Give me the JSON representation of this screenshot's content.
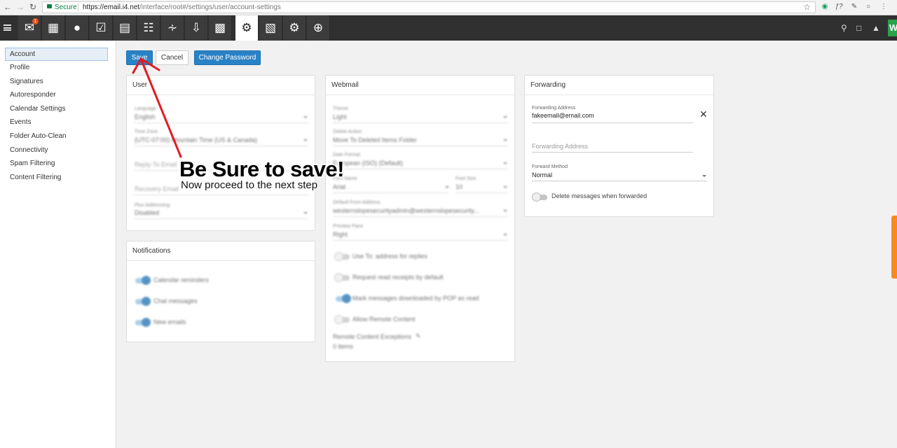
{
  "browser": {
    "secure_label": "Secure",
    "url_host": "https://email.i4.net",
    "url_path": "/interface/root#/settings/user/account-settings"
  },
  "appbar": {
    "mail_badge": "1",
    "avatar_letter": "W"
  },
  "sidebar": {
    "items": [
      {
        "label": "Account"
      },
      {
        "label": "Profile"
      },
      {
        "label": "Signatures"
      },
      {
        "label": "Autoresponder"
      },
      {
        "label": "Calendar Settings"
      },
      {
        "label": "Events"
      },
      {
        "label": "Folder Auto-Clean"
      },
      {
        "label": "Connectivity"
      },
      {
        "label": "Spam Filtering"
      },
      {
        "label": "Content Filtering"
      }
    ]
  },
  "actions": {
    "save": "Save",
    "cancel": "Cancel",
    "change_password": "Change Password"
  },
  "user_card": {
    "title": "User",
    "language_label": "Language",
    "language_value": "English",
    "timezone_label": "Time Zone",
    "timezone_value": "(UTC-07:00) Mountain Time (US & Canada)",
    "reply_to_label": "Reply-To Email",
    "recovery_label": "Recovery Email",
    "plus_addressing_label": "Plus Addressing",
    "plus_addressing_value": "Disabled"
  },
  "notifications_card": {
    "title": "Notifications",
    "items": [
      {
        "label": "Calendar reminders"
      },
      {
        "label": "Chat messages"
      },
      {
        "label": "New emails"
      }
    ]
  },
  "webmail_card": {
    "title": "Webmail",
    "theme_label": "Theme",
    "theme_value": "Light",
    "delete_action_label": "Delete Action",
    "delete_action_value": "Move To Deleted Items Folder",
    "date_format_label": "Date Format",
    "date_format_value": "European (ISO) (Default)",
    "font_label": "Font Name",
    "font_value": "Arial",
    "font_size_label": "Font Size",
    "font_size_value": "10",
    "from_label": "Default From Address",
    "from_value": "westernslopesecurityadmin@westernslopesecurity...",
    "preview_label": "Preview Pane",
    "preview_value": "Right",
    "toggles": [
      {
        "label": "Use To: address for replies"
      },
      {
        "label": "Request read receipts by default"
      },
      {
        "label": "Mark messages downloaded by POP as read"
      },
      {
        "label": "Allow Remote Content"
      }
    ],
    "exceptions_label": "Remote Content Exceptions",
    "exceptions_value": "0 items"
  },
  "forwarding_card": {
    "title": "Forwarding",
    "address_label": "Forwarding Address",
    "address_value": "fakeemail@email.com",
    "address_placeholder": "Forwarding Address",
    "method_label": "Forward Method",
    "method_value": "Normal",
    "delete_toggle_label": "Delete messages when forwarded"
  },
  "annotation": {
    "title": "Be Sure to save!",
    "subtitle": "Now proceed to the next step"
  },
  "colors": {
    "primary": "#2a82c6",
    "toolbar": "#303030",
    "annotation_arrow": "#e21b23",
    "orange_tab": "#f58a1f"
  }
}
